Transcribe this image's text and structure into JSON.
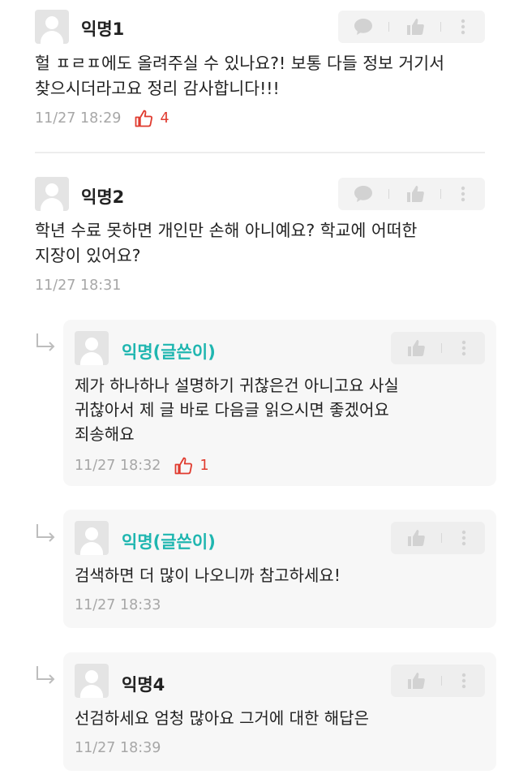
{
  "comments": [
    {
      "author": "익명1",
      "lines": [
        "헐 ㅍㄹㅍ에도 올려주실 수 있나요?! 보통 다들 정보 거기서",
        "찾으시더라고요 정리 감사합니다!!!"
      ],
      "time": "11/27 18:29",
      "likes": "4"
    },
    {
      "author": "익명2",
      "lines": [
        "학년 수료 못하면 개인만 손해 아니예요? 학교에 어떠한",
        "지장이 있어요?"
      ],
      "time": "11/27 18:31"
    }
  ],
  "replies": [
    {
      "author": "익명(글쓴이)",
      "lines": [
        "제가 하나하나 설명하기 귀찮은건 아니고요 사실",
        "귀찮아서 제 글 바로 다음글 읽으시면 좋겠어요",
        "죄송해요"
      ],
      "time": "11/27 18:32",
      "likes": "1"
    },
    {
      "author": "익명(글쓴이)",
      "lines": [
        "검색하면 더 많이 나오니까 참고하세요!"
      ],
      "time": "11/27 18:33"
    },
    {
      "author": "익명4",
      "lines": [
        "선검하세요 엄청 많아요 그거에 대한 해답은"
      ],
      "time": "11/27 18:39"
    }
  ],
  "colors": {
    "op_name": "#1fb6b0",
    "like_accent": "#e03b2f",
    "icon_gray": "#d2d2d2",
    "meta_gray": "#a7a7a7"
  },
  "icons": {
    "comment": "speech-bubble-icon",
    "like": "thumbs-up-icon",
    "more": "vertical-dots-icon",
    "reply": "reply-arrow-icon"
  }
}
